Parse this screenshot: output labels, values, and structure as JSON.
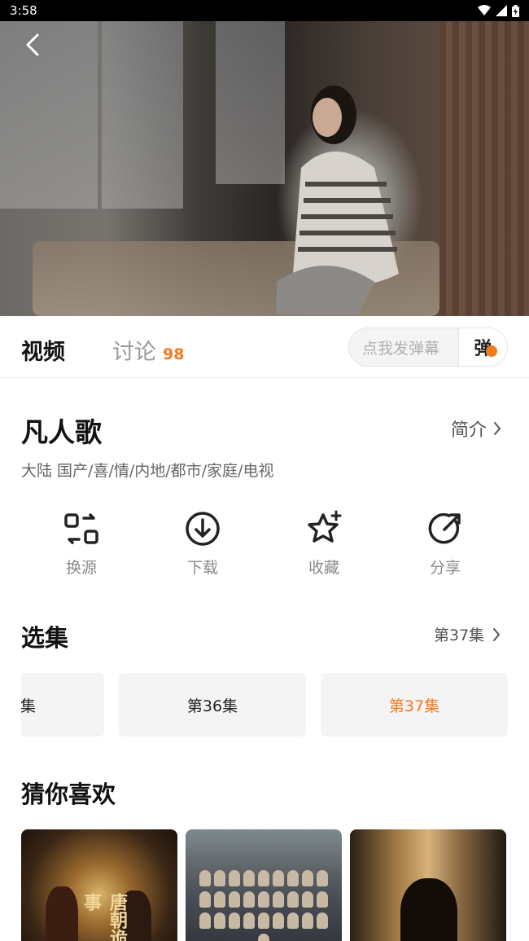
{
  "status": {
    "time": "3:58"
  },
  "tabs": {
    "video": "视频",
    "discuss": "讨论",
    "discuss_count": "98"
  },
  "danmaku": {
    "placeholder": "点我发弹幕",
    "button": "弹"
  },
  "show": {
    "title": "凡人歌",
    "intro": "简介",
    "meta": "大陆  国产/喜/情/内地/都市/家庭/电视"
  },
  "actions": [
    {
      "label": "换源",
      "icon": "switch-source-icon"
    },
    {
      "label": "下载",
      "icon": "download-icon"
    },
    {
      "label": "收藏",
      "icon": "star-add-icon"
    },
    {
      "label": "分享",
      "icon": "share-icon"
    }
  ],
  "episodes": {
    "title": "选集",
    "current": "第37集",
    "items": [
      "集",
      "第36集",
      "第37集"
    ],
    "selected_index": 2
  },
  "recommend": {
    "title": "猜你喜欢",
    "posters": [
      {
        "title_art": "唐朝诡事"
      },
      {
        "title_art": ""
      },
      {
        "title_art": ""
      }
    ]
  },
  "colors": {
    "accent": "#f47a1f"
  }
}
